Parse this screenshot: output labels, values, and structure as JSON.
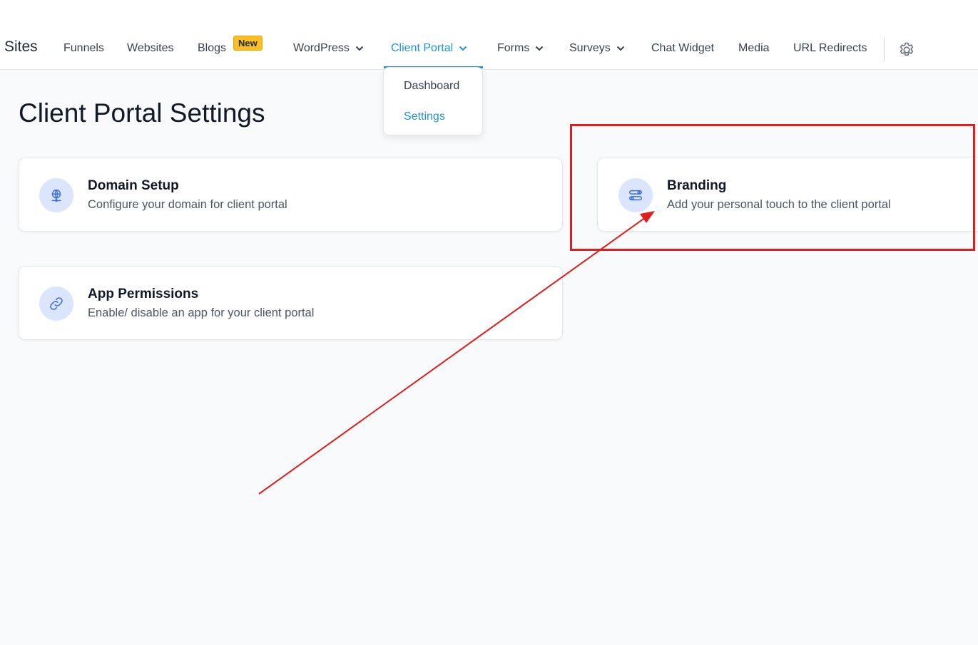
{
  "topnav": {
    "brand": "Sites",
    "items": [
      {
        "label": "Funnels"
      },
      {
        "label": "Websites"
      },
      {
        "label": "Blogs"
      },
      {
        "label": "WordPress"
      },
      {
        "label": "Client Portal"
      },
      {
        "label": "Forms"
      },
      {
        "label": "Surveys"
      },
      {
        "label": "Chat Widget"
      },
      {
        "label": "Media"
      },
      {
        "label": "URL Redirects"
      }
    ],
    "blogs_badge": "New",
    "settings_icon": "gear-icon"
  },
  "dropdown": {
    "items": [
      {
        "label": "Dashboard"
      },
      {
        "label": "Settings"
      }
    ]
  },
  "page": {
    "title": "Client Portal Settings"
  },
  "cards": [
    {
      "title": "Domain Setup",
      "description": "Configure your domain for client portal",
      "icon": "globe-icon"
    },
    {
      "title": "Branding",
      "description": "Add your personal touch to the client portal",
      "icon": "toggles-icon"
    },
    {
      "title": "App Permissions",
      "description": "Enable/ disable an app for your client portal",
      "icon": "link-icon"
    }
  ],
  "colors": {
    "accent": "#1f93d8",
    "badge": "#fbbf24",
    "icon_bg": "#dbe5fd",
    "icon_fg": "#3b6fe0",
    "annotation": "#e11d1d"
  }
}
